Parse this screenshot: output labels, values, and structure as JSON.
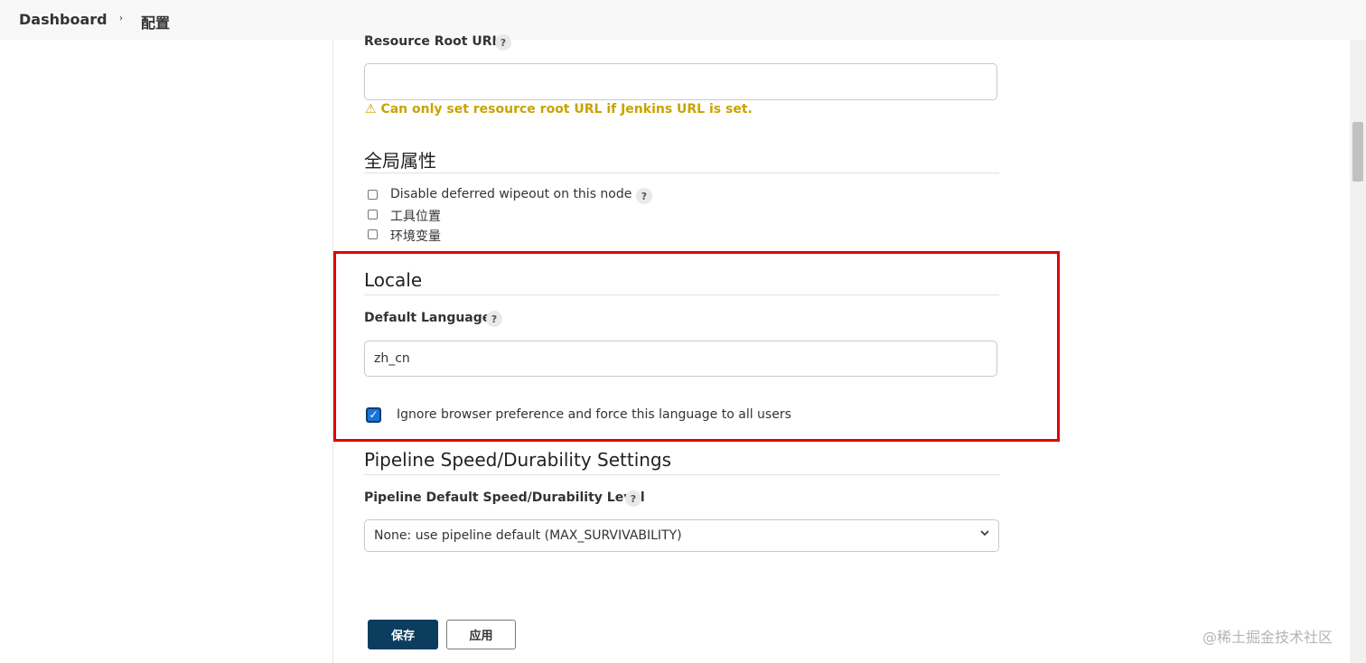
{
  "breadcrumb": {
    "root": "Dashboard",
    "separator": "›",
    "current": "配置"
  },
  "resource_root": {
    "label": "Resource Root URL",
    "help": "?",
    "value": "",
    "warning_icon": "⚠",
    "warning": "Can only set resource root URL if Jenkins URL is set."
  },
  "global_properties": {
    "title": "全局属性",
    "items": [
      {
        "label": "Disable deferred wipeout on this node",
        "checked": false,
        "help": "?"
      },
      {
        "label": "工具位置",
        "checked": false
      },
      {
        "label": "环境变量",
        "checked": false
      }
    ]
  },
  "locale": {
    "title": "Locale",
    "default_language_label": "Default Language",
    "help": "?",
    "default_language_value": "zh_cn",
    "force_label": "Ignore browser preference and force this language to all users",
    "force_checked": true,
    "check_glyph": "✓"
  },
  "pipeline": {
    "title": "Pipeline Speed/Durability Settings",
    "level_label": "Pipeline Default Speed/Durability Level",
    "help": "?",
    "selected": "None: use pipeline default (MAX_SURVIVABILITY)"
  },
  "buttons": {
    "save": "保存",
    "apply": "应用"
  },
  "watermark": "@稀土掘金技术社区",
  "colors": {
    "highlight": "#e00000",
    "warning": "#c9a300",
    "primary_button": "#0c3d5f",
    "checkbox_checked": "#1a73d6"
  }
}
